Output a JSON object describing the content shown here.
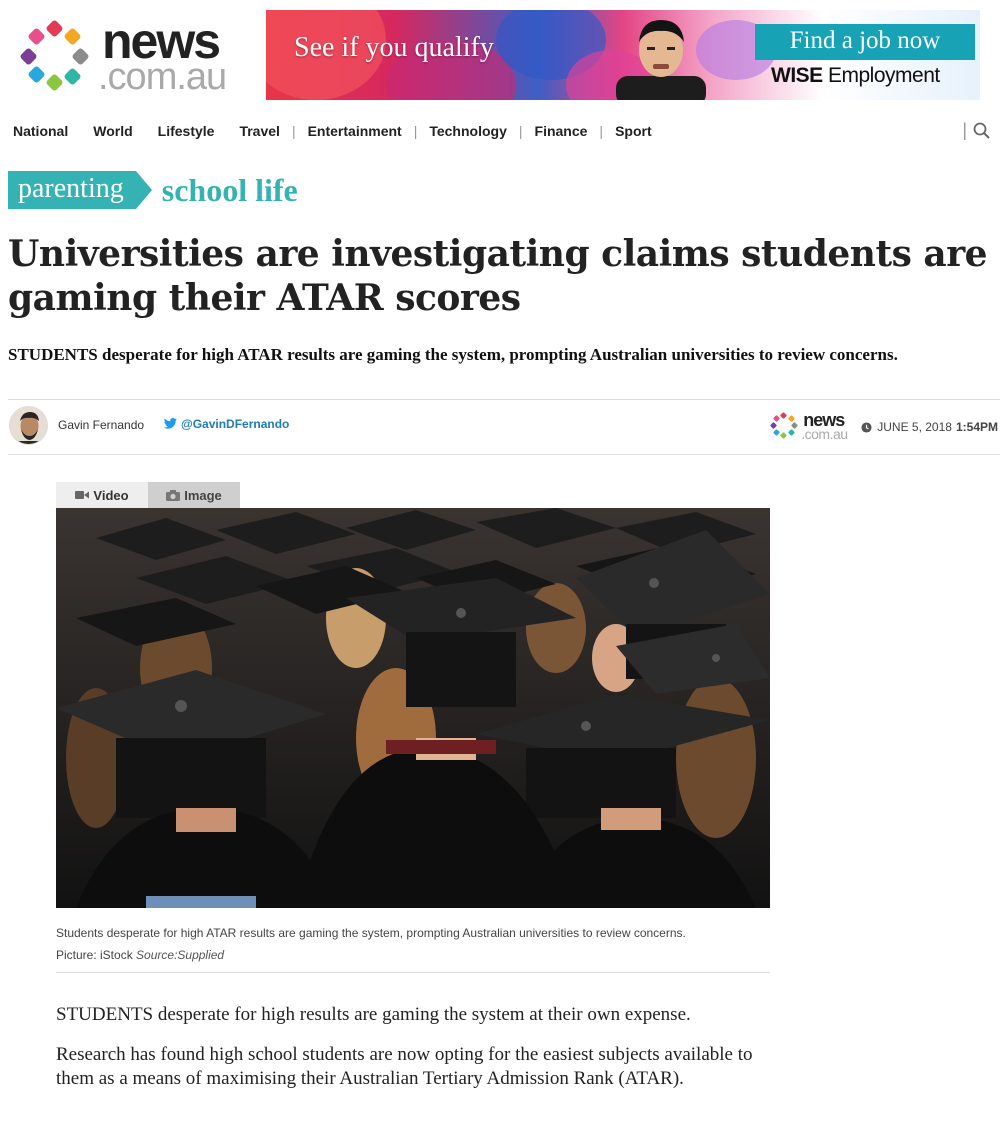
{
  "logo": {
    "word1": "news",
    "word2": ".com.au"
  },
  "ad": {
    "slogan": "See if you qualify",
    "cta": "Find a job now",
    "brand_bold": "WISE",
    "brand_rest": " Employment"
  },
  "nav": {
    "items": [
      "National",
      "World",
      "Lifestyle",
      "Travel",
      "Entertainment",
      "Technology",
      "Finance",
      "Sport"
    ]
  },
  "section": {
    "tag": "parenting",
    "sub": "school life"
  },
  "article": {
    "headline": "Universities are investigating claims students are gaming their ATAR scores",
    "standfirst": "STUDENTS desperate for high ATAR results are gaming the system, prompting Australian universities to review concerns.",
    "author": "Gavin Fernando",
    "twitter": "@GavinDFernando",
    "mini_logo_word1": "news",
    "mini_logo_word2": ".com.au",
    "date": "JUNE 5, 2018",
    "time": "1:54PM",
    "media_tabs": {
      "video": "Video",
      "image": "Image"
    },
    "caption_text": "Students desperate for high ATAR results are gaming the system, prompting Australian universities to review concerns.",
    "caption_credit": "Picture: iStock",
    "caption_source": "Source:Supplied",
    "paragraphs": [
      "STUDENTS desperate for high results are gaming the system at their own expense.",
      "Research has found high school students are now opting for the easiest subjects available to them as a means of maximising their Australian Tertiary Admission Rank (ATAR)."
    ]
  },
  "colors": {
    "accent": "#35b3b4",
    "twitter": "#1d7bb8",
    "ad_cta": "#17a2b5"
  }
}
